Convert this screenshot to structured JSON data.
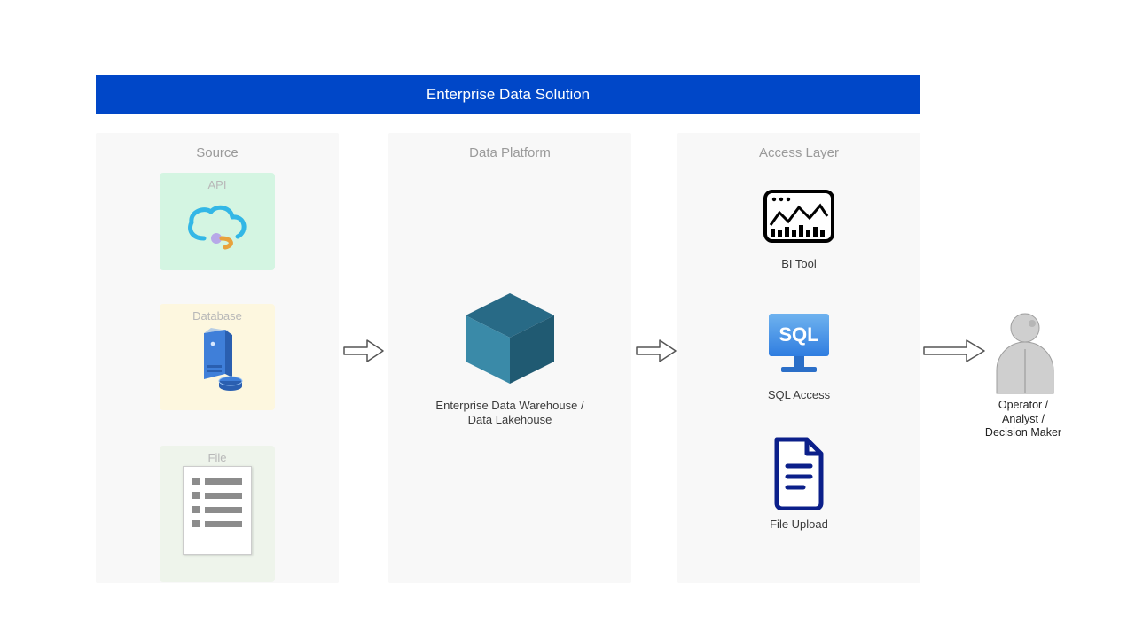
{
  "title": "Enterprise Data Solution",
  "columns": {
    "source": {
      "title": "Source"
    },
    "platform": {
      "title": "Data Platform",
      "item_label": "Enterprise Data Warehouse /\nData Lakehouse"
    },
    "access": {
      "title": "Access Layer"
    }
  },
  "source_items": {
    "api": {
      "label": "API"
    },
    "database": {
      "label": "Database"
    },
    "file": {
      "label": "File"
    }
  },
  "access_items": {
    "bi": {
      "label": "BI Tool"
    },
    "sql": {
      "label": "SQL Access",
      "badge": "SQL"
    },
    "file": {
      "label": "File Upload"
    }
  },
  "user": {
    "label": "Operator /\nAnalyst /\nDecision Maker"
  }
}
